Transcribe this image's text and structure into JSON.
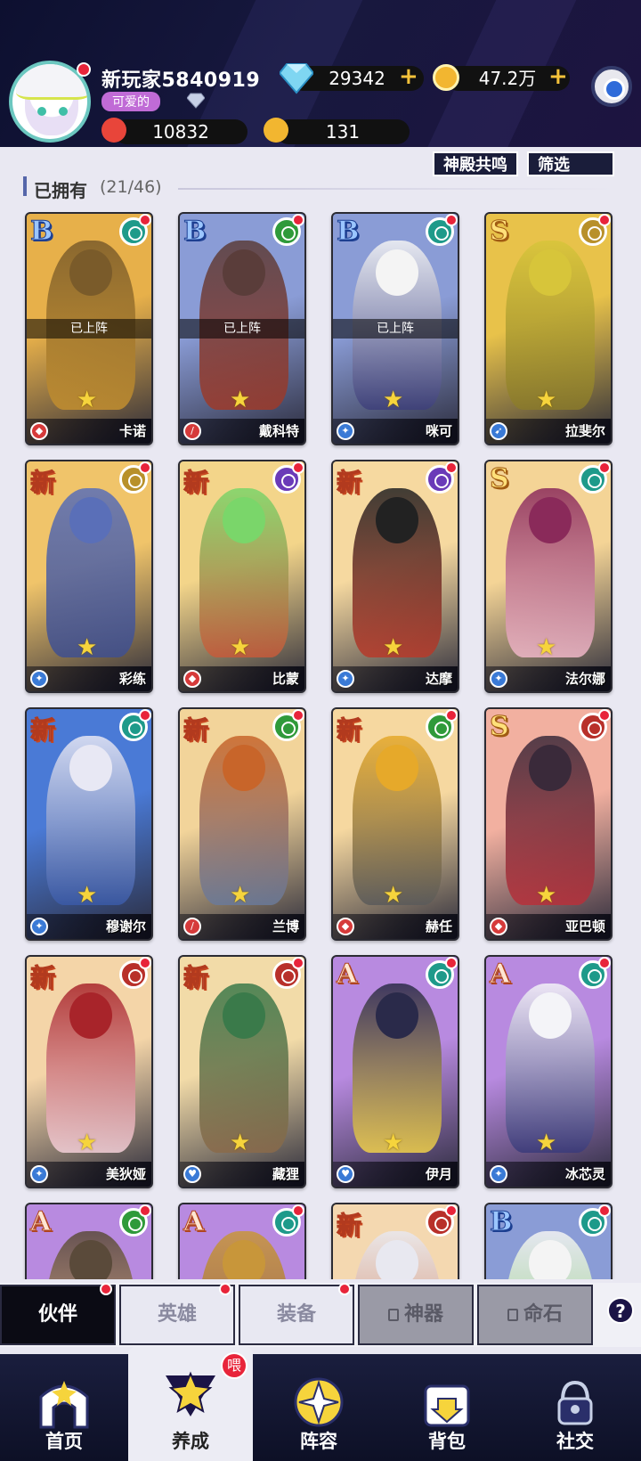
{
  "player": {
    "name": "新玩家5840919",
    "title": "可爱的"
  },
  "resources": {
    "diamonds": "29342",
    "gold": "47.2万",
    "power": "10832",
    "stars": "131"
  },
  "header_buttons": {
    "resonance": "神殿共鸣",
    "filter": "筛选"
  },
  "owned": {
    "label": "已拥有",
    "count": "(21/46)"
  },
  "deployed_label": "已上阵",
  "colors": {
    "accent": "#e8243a",
    "star": "#f6d43c",
    "header_bg": "#17183e",
    "page_bg": "#e9e8f2"
  },
  "cards": [
    {
      "grade": "B",
      "name": "卡诺",
      "deployed": true,
      "element": "wind-icon",
      "role": "shield-icon",
      "palette": [
        "#e7b04a",
        "#7a5b2a",
        "#c38f2f"
      ]
    },
    {
      "grade": "B",
      "name": "戴科特",
      "deployed": true,
      "element": "leaf-icon",
      "role": "sword-icon",
      "palette": [
        "#8a9cd6",
        "#5a3d3a",
        "#9e3a2a"
      ]
    },
    {
      "grade": "B",
      "name": "咪可",
      "deployed": true,
      "element": "wind-icon",
      "role": "staff-icon",
      "palette": [
        "#8a9cd6",
        "#f4f4f4",
        "#3d3f7a"
      ]
    },
    {
      "grade": "S",
      "name": "拉斐尔",
      "deployed": false,
      "element": "cross-icon",
      "role": "gun-icon",
      "palette": [
        "#e8c24a",
        "#d7c53a",
        "#8a7a2a"
      ]
    },
    {
      "grade": "新",
      "name": "彩练",
      "deployed": false,
      "element": "cross-icon",
      "role": "staff-icon",
      "palette": [
        "#f0c46a",
        "#5a6fb8",
        "#3f4f8f"
      ]
    },
    {
      "grade": "新",
      "name": "比蒙",
      "deployed": false,
      "element": "moon-icon",
      "role": "shield-icon",
      "palette": [
        "#f3d58a",
        "#7ad66a",
        "#c75a3a"
      ]
    },
    {
      "grade": "新",
      "name": "达摩",
      "deployed": false,
      "element": "moon-icon",
      "role": "staff-icon",
      "palette": [
        "#f6d9a0",
        "#222222",
        "#b83a2a"
      ]
    },
    {
      "grade": "S",
      "name": "法尔娜",
      "deployed": false,
      "element": "wind-icon",
      "role": "staff-icon",
      "palette": [
        "#f4d496",
        "#8a2a5a",
        "#f0b8c8"
      ]
    },
    {
      "grade": "新",
      "name": "穆谢尔",
      "deployed": false,
      "element": "wind-icon",
      "role": "staff-icon",
      "palette": [
        "#4a7ad6",
        "#e8e8f4",
        "#3a5aa8"
      ]
    },
    {
      "grade": "新",
      "name": "兰博",
      "deployed": false,
      "element": "leaf-icon",
      "role": "sword-icon",
      "palette": [
        "#f2d49a",
        "#c8652a",
        "#6a7a9a"
      ]
    },
    {
      "grade": "新",
      "name": "赫任",
      "deployed": false,
      "element": "leaf-icon",
      "role": "shield-icon",
      "palette": [
        "#f6d8a0",
        "#e6a92a",
        "#5a5a5a"
      ]
    },
    {
      "grade": "S",
      "name": "亚巴顿",
      "deployed": false,
      "element": "fire-icon",
      "role": "shield-icon",
      "palette": [
        "#f2b0a0",
        "#3a2a3a",
        "#b8303a"
      ]
    },
    {
      "grade": "新",
      "name": "美狄娅",
      "deployed": false,
      "element": "fire-icon",
      "role": "staff-icon",
      "palette": [
        "#f4d5a8",
        "#a8242a",
        "#f4d0d8"
      ]
    },
    {
      "grade": "新",
      "name": "藏狸",
      "deployed": false,
      "element": "fire-icon",
      "role": "heart-icon",
      "palette": [
        "#f2dba8",
        "#3a7a4a",
        "#8a6a4a"
      ]
    },
    {
      "grade": "A",
      "name": "伊月",
      "deployed": false,
      "element": "wind-icon",
      "role": "heart-icon",
      "palette": [
        "#b88ae0",
        "#2a2a4a",
        "#f0d04a"
      ]
    },
    {
      "grade": "A",
      "name": "冰芯灵",
      "deployed": false,
      "element": "wind-icon",
      "role": "staff-icon",
      "palette": [
        "#b88ae0",
        "#f4f4f8",
        "#3a3a7a"
      ]
    },
    {
      "grade": "A",
      "name": "",
      "deployed": false,
      "element": "leaf-icon",
      "role": "",
      "palette": [
        "#b88ae0",
        "#5a4a3a",
        "#f0c07a"
      ]
    },
    {
      "grade": "A",
      "name": "",
      "deployed": false,
      "element": "wind-icon",
      "role": "",
      "palette": [
        "#b88ae0",
        "#c8963a",
        "#8a5a2a"
      ]
    },
    {
      "grade": "新",
      "name": "",
      "deployed": false,
      "element": "fire-icon",
      "role": "",
      "palette": [
        "#f4d8b0",
        "#e8e8f0",
        "#c8653a"
      ]
    },
    {
      "grade": "B",
      "name": "",
      "deployed": false,
      "element": "wind-icon",
      "role": "",
      "palette": [
        "#8a9cd6",
        "#f4f4f4",
        "#8ad65a"
      ]
    }
  ],
  "subtabs": [
    {
      "label": "伙伴",
      "active": true,
      "locked": false
    },
    {
      "label": "英雄",
      "active": false,
      "locked": false
    },
    {
      "label": "装备",
      "active": false,
      "locked": false
    },
    {
      "label": "神器",
      "active": false,
      "locked": true
    },
    {
      "label": "命石",
      "active": false,
      "locked": true
    }
  ],
  "help_label": "?",
  "nav": [
    {
      "label": "首页",
      "icon": "home-icon",
      "active": false
    },
    {
      "label": "养成",
      "icon": "star-icon",
      "active": true,
      "badge": "喂"
    },
    {
      "label": "阵容",
      "icon": "compass-icon",
      "active": false
    },
    {
      "label": "背包",
      "icon": "bag-icon",
      "active": false
    },
    {
      "label": "社交",
      "icon": "social-icon",
      "active": false
    }
  ]
}
